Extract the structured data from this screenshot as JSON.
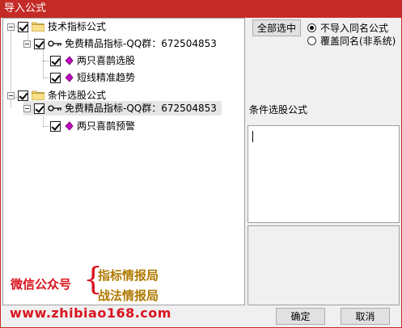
{
  "window": {
    "title": "导入公式"
  },
  "tree": {
    "groups": [
      {
        "label": "技术指标公式",
        "source": {
          "label": "免费精品指标-QQ群：672504853"
        },
        "items": [
          {
            "label": "两只喜鹊选股"
          },
          {
            "label": "短线精准趋势"
          }
        ]
      },
      {
        "label": "条件选股公式",
        "source": {
          "label": "免费精品指标-QQ群：672504853"
        },
        "items": [
          {
            "label": "两只喜鹊预警"
          }
        ]
      }
    ]
  },
  "controls": {
    "select_all_label": "全部选中",
    "options": [
      {
        "label": "不导入同名公式"
      },
      {
        "label": "覆盖同名(非系统)"
      }
    ],
    "selected_option": 0
  },
  "detail": {
    "label": "条件选股公式"
  },
  "watermark": {
    "wechat_label": "微信公众号",
    "line1": "指标情报局",
    "line2": "战法情报局",
    "site": "www.zhibiao168.com"
  },
  "footer": {
    "ok_label": "确定",
    "cancel_label": "取消"
  },
  "colors": {
    "titlebar": "#c42b26",
    "watermark_red": "#d9141f",
    "watermark_gold": "#b07a00",
    "gem": "#c400c4"
  }
}
